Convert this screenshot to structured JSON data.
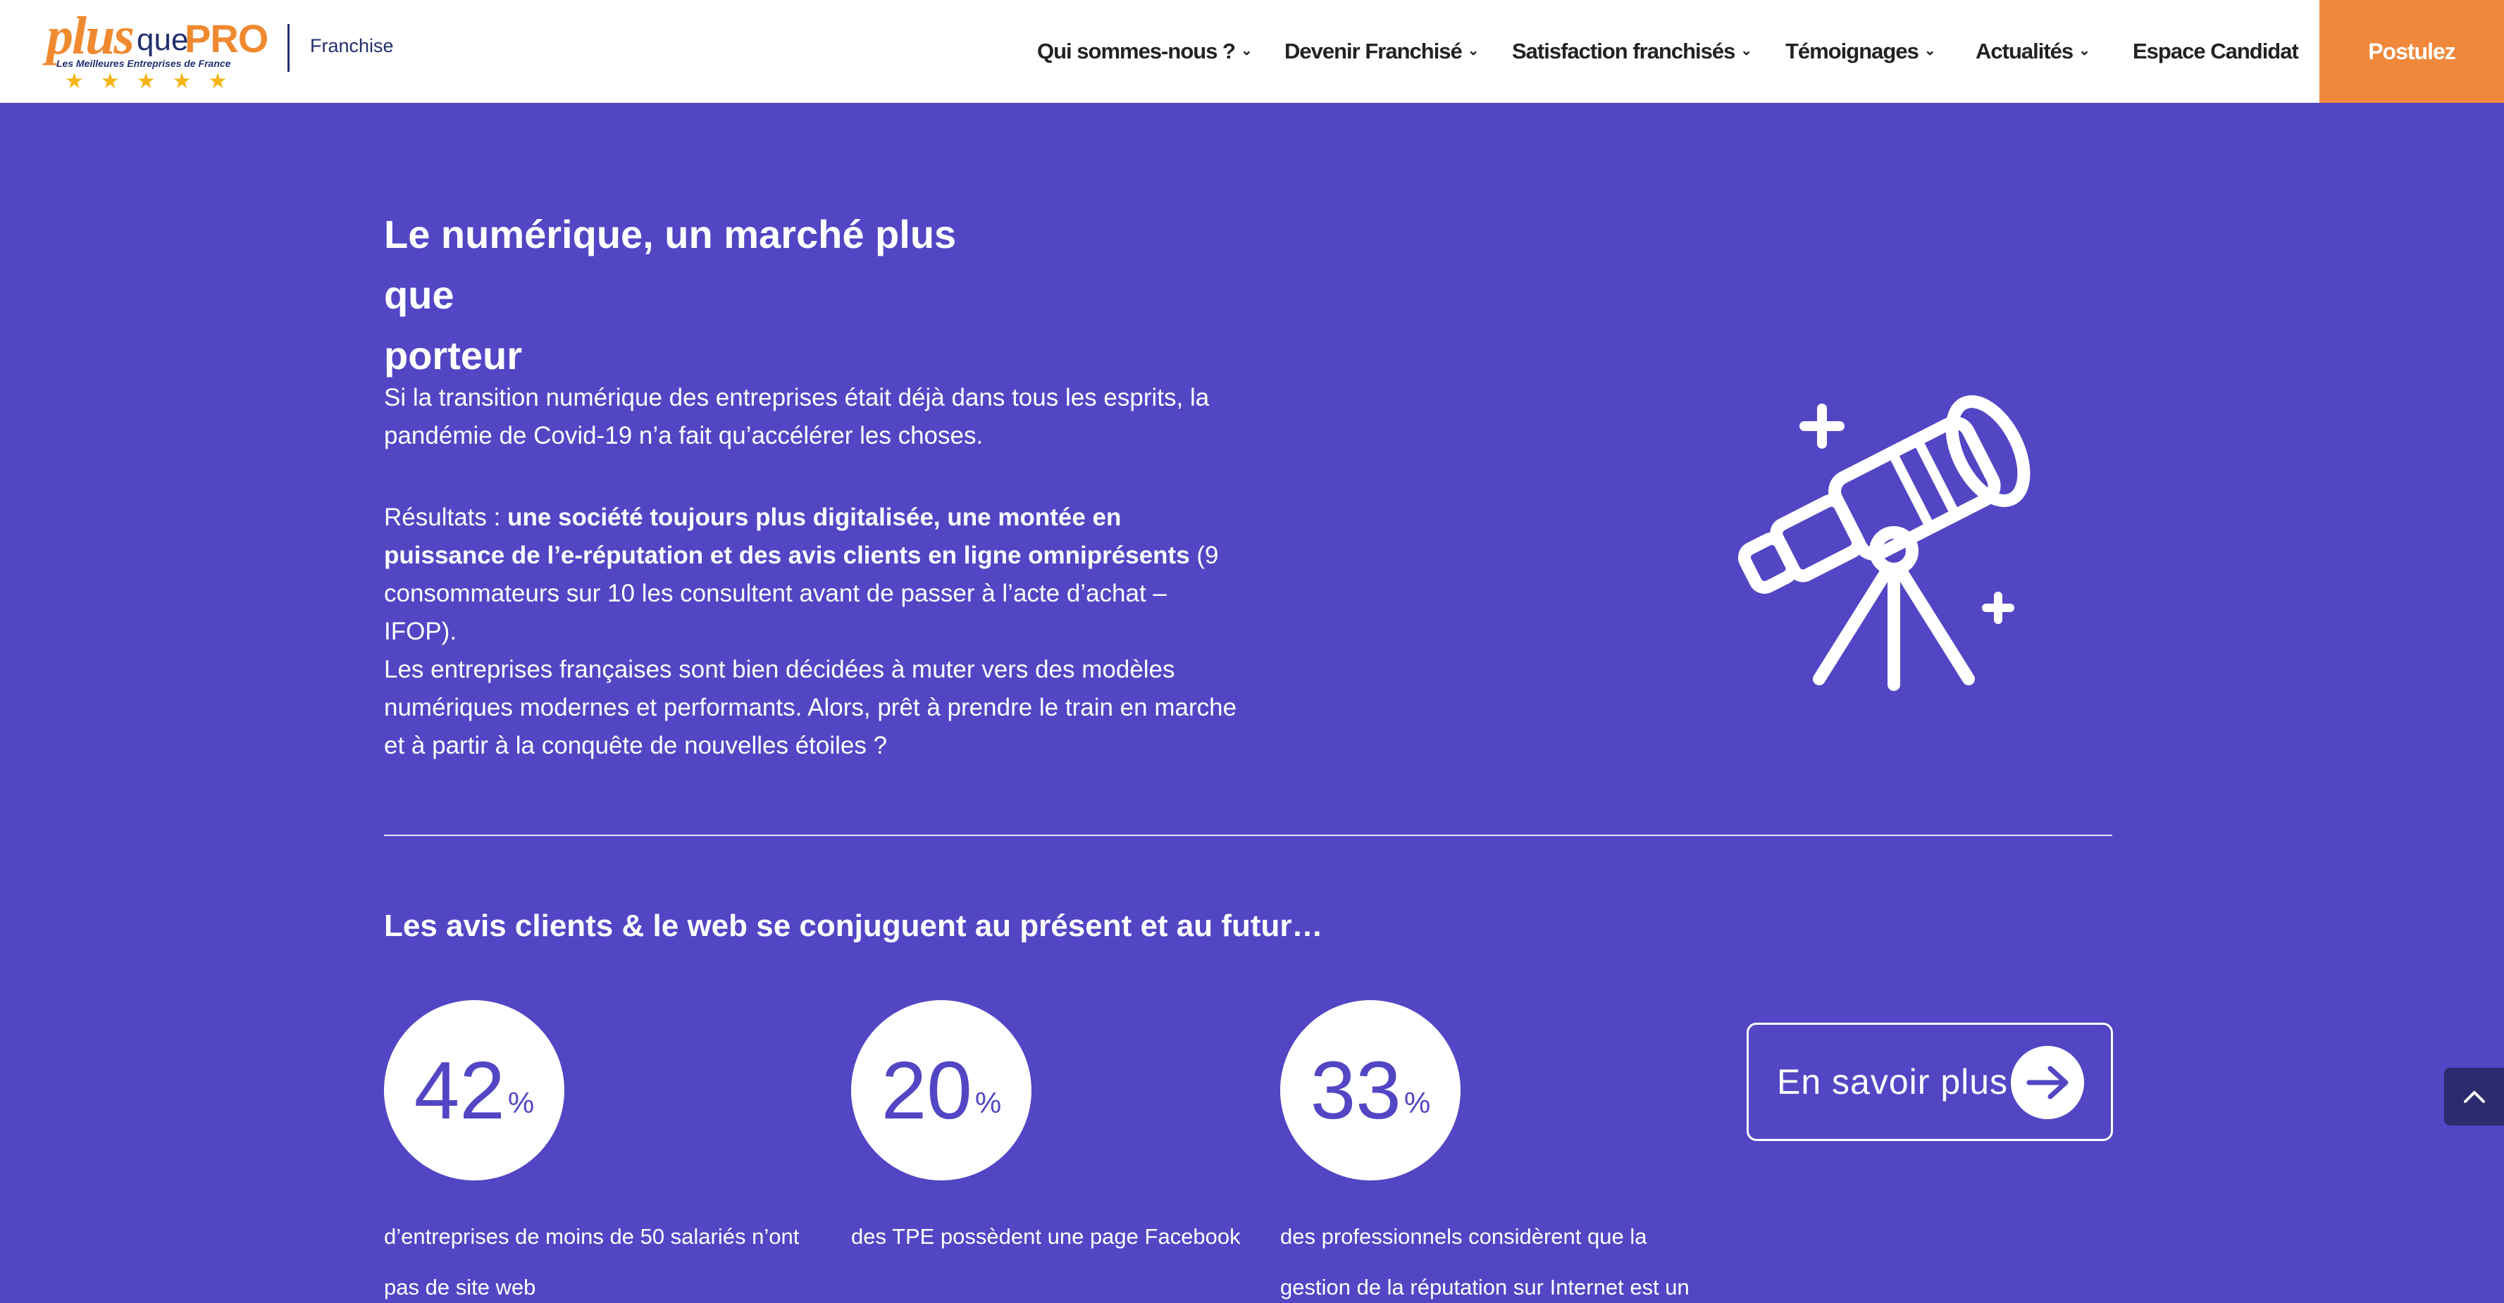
{
  "header": {
    "logo": {
      "plus": "plus",
      "que": "que",
      "pro": "PRO",
      "tagline": "Les Meilleures Entreprises de France",
      "stars": "★★★★★"
    },
    "section_label": "Franchise",
    "nav": [
      {
        "label": "Qui sommes-nous ?",
        "has_dropdown": true
      },
      {
        "label": "Devenir Franchisé",
        "has_dropdown": true
      },
      {
        "label": "Satisfaction franchisés",
        "has_dropdown": true
      },
      {
        "label": "Témoignages",
        "has_dropdown": true
      },
      {
        "label": "Actualités",
        "has_dropdown": true
      },
      {
        "label": "Espace Candidat",
        "has_dropdown": false
      }
    ],
    "cta": "Postulez"
  },
  "intro": {
    "title_line1": "Le numérique, un marché plus que",
    "title_line2": "porteur",
    "p1": "Si la transition numérique des entreprises était déjà dans tous les esprits, la pandémie de Covid-19 n’a fait qu’accélérer les choses.",
    "p2_prefix": "Résultats : ",
    "p2_bold": "une société toujours plus digitalisée, une montée en puissance de l’e-réputation et des avis clients en ligne omniprésents",
    "p2_suffix": " (9 consommateurs sur 10 les consultent avant de passer à l’acte d’achat – IFOP).",
    "p3": "Les entreprises françaises sont bien décidées à muter vers des modèles numériques modernes et performants. Alors, prêt à prendre le train en marche et à partir à la conquête de nouvelles étoiles ?",
    "illustration": "telescope-icon"
  },
  "stats_section": {
    "title": "Les avis clients & le web se conjuguent au présent et au futur…",
    "stats": [
      {
        "value": "42",
        "unit": "%",
        "desc_line1": "d’entreprises de moins de 50 salariés n’ont",
        "desc_line2": "pas de site web"
      },
      {
        "value": "20",
        "unit": "%",
        "desc_line1": "des TPE possèdent une page Facebook",
        "desc_line2": ""
      },
      {
        "value": "33",
        "unit": "%",
        "desc_line1": "des professionnels considèrent que la",
        "desc_line2": "gestion de la réputation sur Internet est un"
      }
    ],
    "button": "En savoir plus"
  },
  "colors": {
    "background": "#5246c4",
    "accent": "#f0883c",
    "navy": "#23306d"
  }
}
